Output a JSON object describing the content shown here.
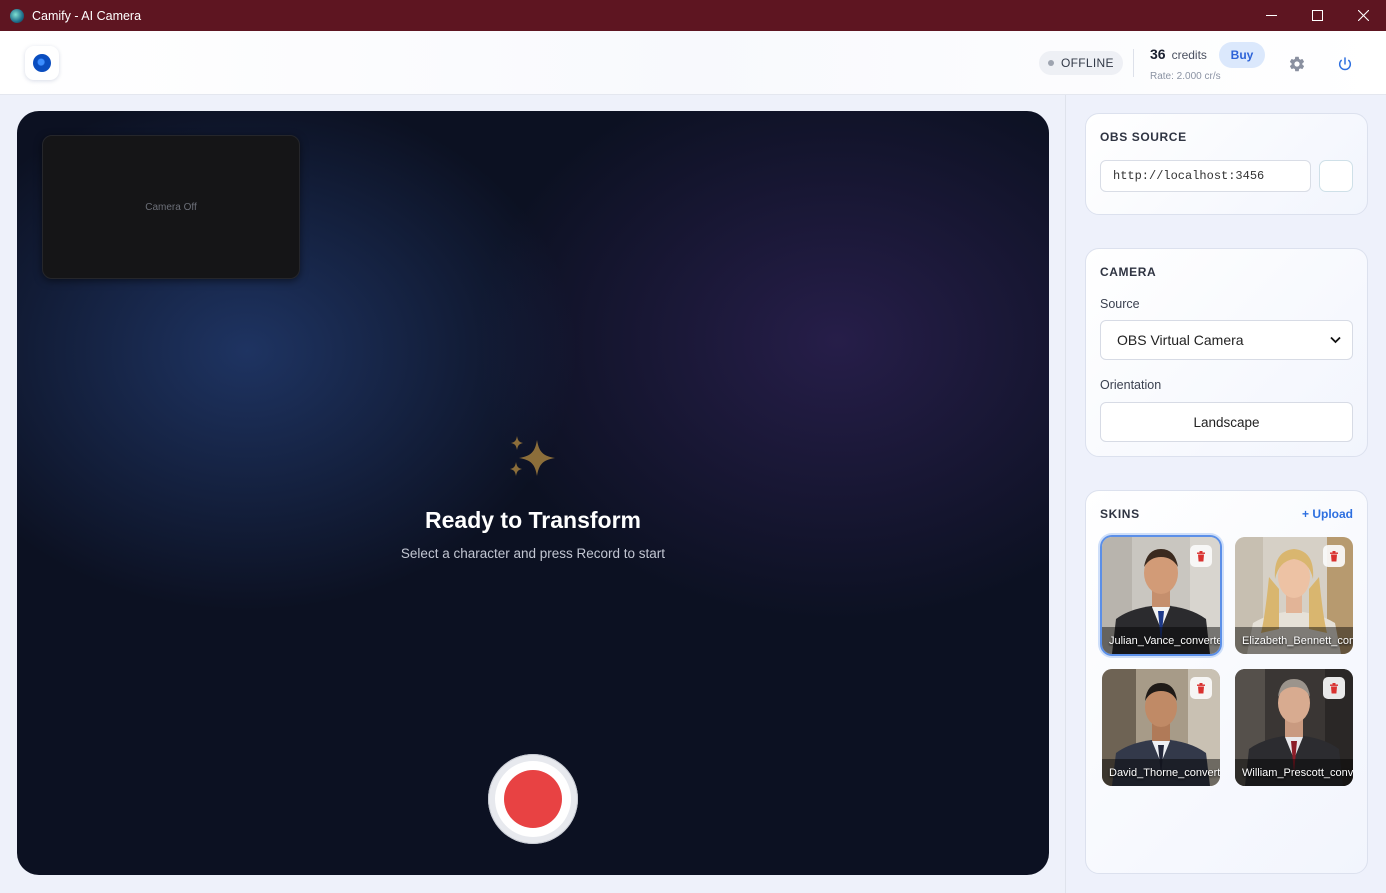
{
  "window": {
    "title": "Camify - AI Camera"
  },
  "header": {
    "status": "OFFLINE",
    "credits_value": "36",
    "credits_label": "credits",
    "buy_label": "Buy",
    "rate_text": "Rate: 2.000 cr/s"
  },
  "stage": {
    "camera_off_text": "Camera Off",
    "title": "Ready to Transform",
    "subtitle": "Select a character and press Record to start"
  },
  "obs_source": {
    "heading": "OBS SOURCE",
    "url_value": "http://localhost:3456"
  },
  "camera": {
    "heading": "CAMERA",
    "source_label": "Source",
    "source_value": "OBS Virtual Camera",
    "orientation_label": "Orientation",
    "orientation_value": "Landscape"
  },
  "skins": {
    "heading": "SKINS",
    "upload_label": "+ Upload",
    "items": [
      {
        "name": "Julian_Vance_converted",
        "selected": true
      },
      {
        "name": "Elizabeth_Bennett_converted",
        "selected": false
      },
      {
        "name": "David_Thorne_converted",
        "selected": false
      },
      {
        "name": "William_Prescott_converted",
        "selected": false
      }
    ]
  },
  "colors": {
    "titlebar": "#5e1521",
    "accent": "#2d6fe0",
    "record": "#e84243",
    "sparkle": "#8c6e3a"
  }
}
